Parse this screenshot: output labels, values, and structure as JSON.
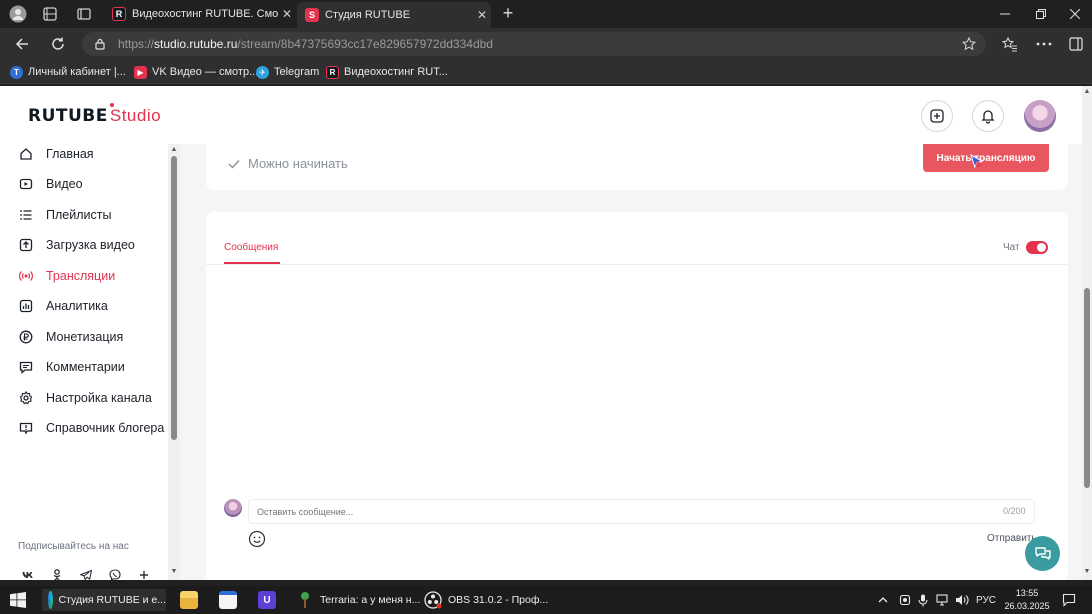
{
  "browser": {
    "tabs": [
      {
        "favicon": "R",
        "title": "Видеохостинг RUTUBE. Смотрите",
        "close": "✕"
      },
      {
        "favicon": "S",
        "title": "Студия RUTUBE",
        "close": "✕"
      }
    ],
    "new_tab": "+",
    "url": {
      "scheme": "https://",
      "host": "studio.rutube.ru",
      "path": "/stream/8b47375693cc17e829657972dd334dbd"
    },
    "bookmarks": [
      {
        "icon": "T",
        "label": "Личный кабинет |...",
        "color": "#2f6fd8"
      },
      {
        "icon": "▶",
        "label": "VK Видео — смотр...",
        "color": "#e3334f"
      },
      {
        "icon": "✈",
        "label": "Telegram",
        "color": "#2aa3e0"
      },
      {
        "icon": "R",
        "label": "Видеохостинг RUT...",
        "color": "#101820"
      }
    ]
  },
  "studio": {
    "logo_main": "RUTUBE",
    "logo_sub": "Studio",
    "accent": "#e3334f",
    "sidebar": {
      "items": [
        {
          "label": "Главная",
          "icon": "home-icon",
          "active": false
        },
        {
          "label": "Видео",
          "icon": "video-icon",
          "active": false
        },
        {
          "label": "Плейлисты",
          "icon": "playlist-icon",
          "active": false
        },
        {
          "label": "Загрузка видео",
          "icon": "upload-icon",
          "active": false
        },
        {
          "label": "Трансляции",
          "icon": "broadcast-icon",
          "active": true
        },
        {
          "label": "Аналитика",
          "icon": "analytics-icon",
          "active": false
        },
        {
          "label": "Монетизация",
          "icon": "ruble-icon",
          "active": false
        },
        {
          "label": "Комментарии",
          "icon": "comments-icon",
          "active": false
        },
        {
          "label": "Настройка канала",
          "icon": "settings-icon",
          "active": false
        },
        {
          "label": "Справочник блогера",
          "icon": "guide-icon",
          "active": false
        }
      ],
      "subscribe_label": "Подписывайтесь на нас",
      "socials": [
        "vk-icon",
        "odnoklassniki-icon",
        "telegram-icon",
        "viber-icon",
        "plus-icon"
      ]
    },
    "status": {
      "text": "Можно начинать",
      "start_button": "Начать трансляцию"
    },
    "chat": {
      "tab_label": "Сообщения",
      "chat_toggle_label": "Чат",
      "chat_enabled": true,
      "input_placeholder": "Оставить сообщение...",
      "counter": "0/200",
      "send_label": "Отправить"
    }
  },
  "taskbar": {
    "apps": [
      {
        "label": "Студия RUTUBE и е...",
        "icon": "edge-icon"
      },
      {
        "label": "",
        "icon": "file-explorer-icon"
      },
      {
        "label": "",
        "icon": "store-icon"
      },
      {
        "label": "",
        "icon": "app-icon"
      },
      {
        "label": "Terraria: а у меня н...",
        "icon": "terraria-icon"
      },
      {
        "label": "OBS 31.0.2 - Проф...",
        "icon": "obs-icon"
      }
    ],
    "language": "РУС",
    "time": "13:55",
    "date": "26.03.2025"
  }
}
